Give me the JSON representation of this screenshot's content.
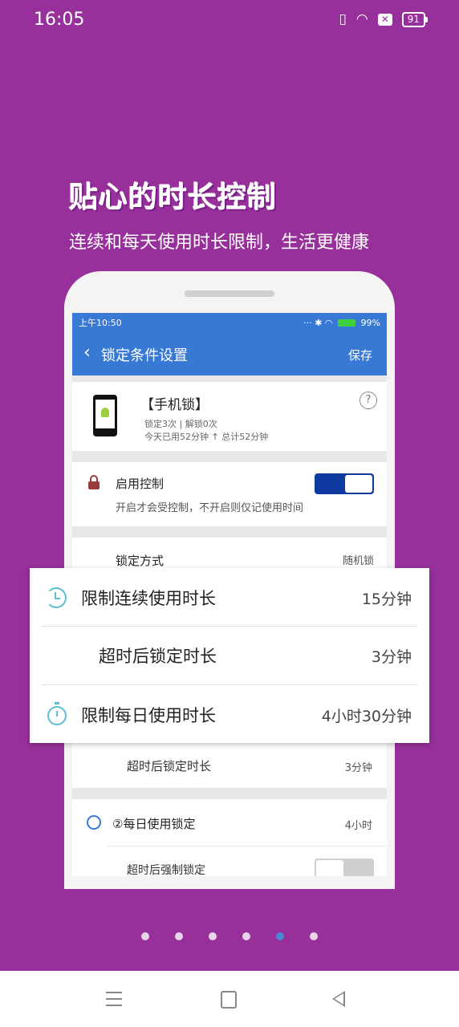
{
  "status_bar": {
    "time": "16:05",
    "battery": "91"
  },
  "headline": "贴心的时长控制",
  "subheadline": "连续和每天使用时长限制，生活更健康",
  "inner": {
    "status_time": "上午10:50",
    "status_battery": "99%",
    "appbar": {
      "title": "锁定条件设置",
      "save": "保存"
    },
    "lock_card": {
      "title": "【手机锁】",
      "line1": "锁定3次 | 解锁0次",
      "line2": "今天已用52分钟 ↑ 总计52分钟",
      "help": "?"
    },
    "enable_card": {
      "title": "启用控制",
      "desc": "开启才会受控制，不开启则仅记使用时间",
      "toggle_on": true
    },
    "mode_card": {
      "title": "锁定方式",
      "value": "随机锁"
    },
    "over_row": {
      "label": "超时后锁定时长",
      "value": "3分钟"
    },
    "daily_card": {
      "title": "②每日使用锁定",
      "value": "4小时",
      "force_label": "超时后强制锁定",
      "force_on": false
    }
  },
  "overlay": {
    "row1": {
      "label": "限制连续使用时长",
      "value": "15分钟"
    },
    "row2": {
      "label": "超时后锁定时长",
      "value": "3分钟"
    },
    "row3": {
      "label": "限制每日使用时长",
      "value": "4小时30分钟"
    }
  },
  "pager": {
    "total": 6,
    "active": 5
  },
  "colors": {
    "background": "#97309a",
    "app_blue": "#3779d4",
    "active_dot": "#4a88d6"
  }
}
